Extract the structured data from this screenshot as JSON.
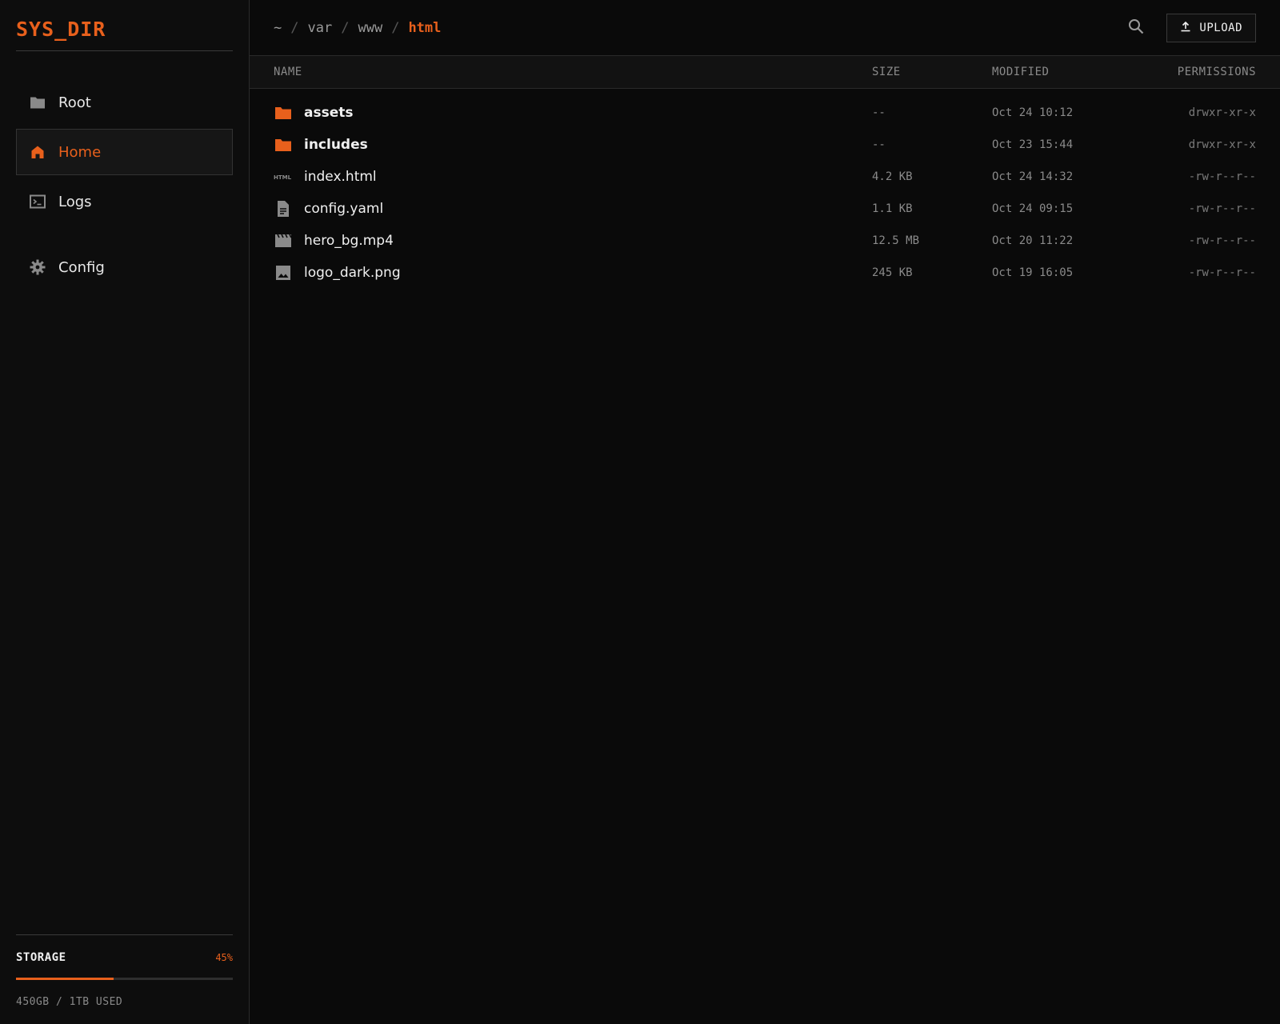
{
  "brand": "SYS_DIR",
  "nav": [
    {
      "label": "Root",
      "icon": "folder-icon"
    },
    {
      "label": "Home",
      "icon": "home-icon",
      "active": true
    },
    {
      "label": "Logs",
      "icon": "terminal-icon"
    },
    {
      "label": "Config",
      "icon": "gear-icon"
    }
  ],
  "storage": {
    "title": "STORAGE",
    "percent_label": "45%",
    "fraction": 0.45,
    "note": "450GB / 1TB USED"
  },
  "breadcrumb": [
    "~",
    "var",
    "www",
    "html"
  ],
  "toolbar": {
    "upload_label": "UPLOAD"
  },
  "table": {
    "headers": {
      "name": "NAME",
      "size": "SIZE",
      "modified": "MODIFIED",
      "permissions": "PERMISSIONS"
    },
    "rows": [
      {
        "name": "assets",
        "type": "folder",
        "size": "--",
        "modified": "Oct 24 10:12",
        "permissions": "drwxr-xr-x"
      },
      {
        "name": "includes",
        "type": "folder",
        "size": "--",
        "modified": "Oct 23 15:44",
        "permissions": "drwxr-xr-x"
      },
      {
        "name": "index.html",
        "type": "html",
        "size": "4.2 KB",
        "modified": "Oct 24 14:32",
        "permissions": "-rw-r--r--"
      },
      {
        "name": "config.yaml",
        "type": "doc",
        "size": "1.1 KB",
        "modified": "Oct 24 09:15",
        "permissions": "-rw-r--r--"
      },
      {
        "name": "hero_bg.mp4",
        "type": "video",
        "size": "12.5 MB",
        "modified": "Oct 20 11:22",
        "permissions": "-rw-r--r--"
      },
      {
        "name": "logo_dark.png",
        "type": "image",
        "size": "245 KB",
        "modified": "Oct 19 16:05",
        "permissions": "-rw-r--r--"
      }
    ]
  },
  "colors": {
    "accent": "#e8601c",
    "background": "#0a0a0a",
    "sidebar": "#0d0d0d"
  }
}
